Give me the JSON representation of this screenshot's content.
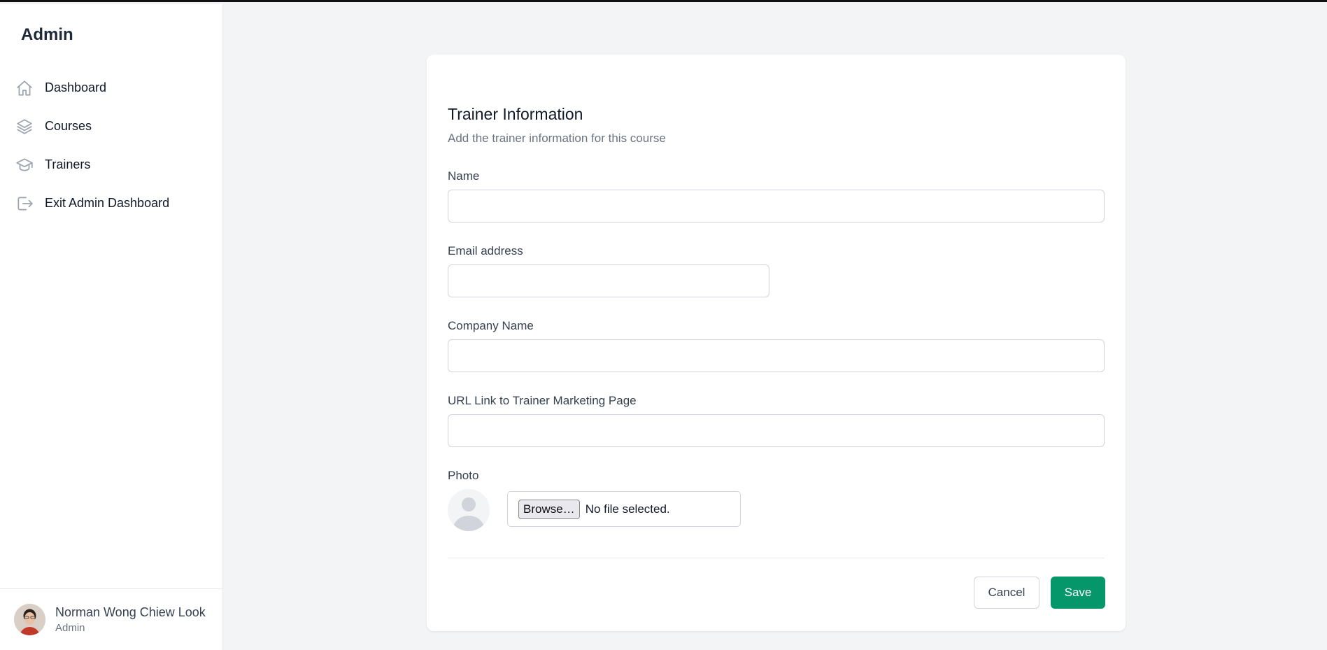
{
  "sidebar": {
    "brand": "Admin",
    "items": [
      {
        "label": "Dashboard",
        "icon": "home-icon"
      },
      {
        "label": "Courses",
        "icon": "layers-icon"
      },
      {
        "label": "Trainers",
        "icon": "graduation-cap-icon"
      },
      {
        "label": "Exit Admin Dashboard",
        "icon": "logout-icon"
      }
    ],
    "profile": {
      "name": "Norman Wong Chiew Look",
      "role": "Admin"
    }
  },
  "form": {
    "title": "Trainer Information",
    "subtitle": "Add the trainer information for this course",
    "fields": {
      "name": {
        "label": "Name",
        "value": ""
      },
      "email": {
        "label": "Email address",
        "value": ""
      },
      "company": {
        "label": "Company Name",
        "value": ""
      },
      "url": {
        "label": "URL Link to Trainer Marketing Page",
        "value": ""
      }
    },
    "photo": {
      "label": "Photo",
      "browse_label": "Browse…",
      "file_status": "No file selected."
    },
    "cancel_label": "Cancel",
    "save_label": "Save"
  },
  "colors": {
    "accent": "#059669",
    "background": "#f3f4f6",
    "icon": "#9ca3af"
  }
}
